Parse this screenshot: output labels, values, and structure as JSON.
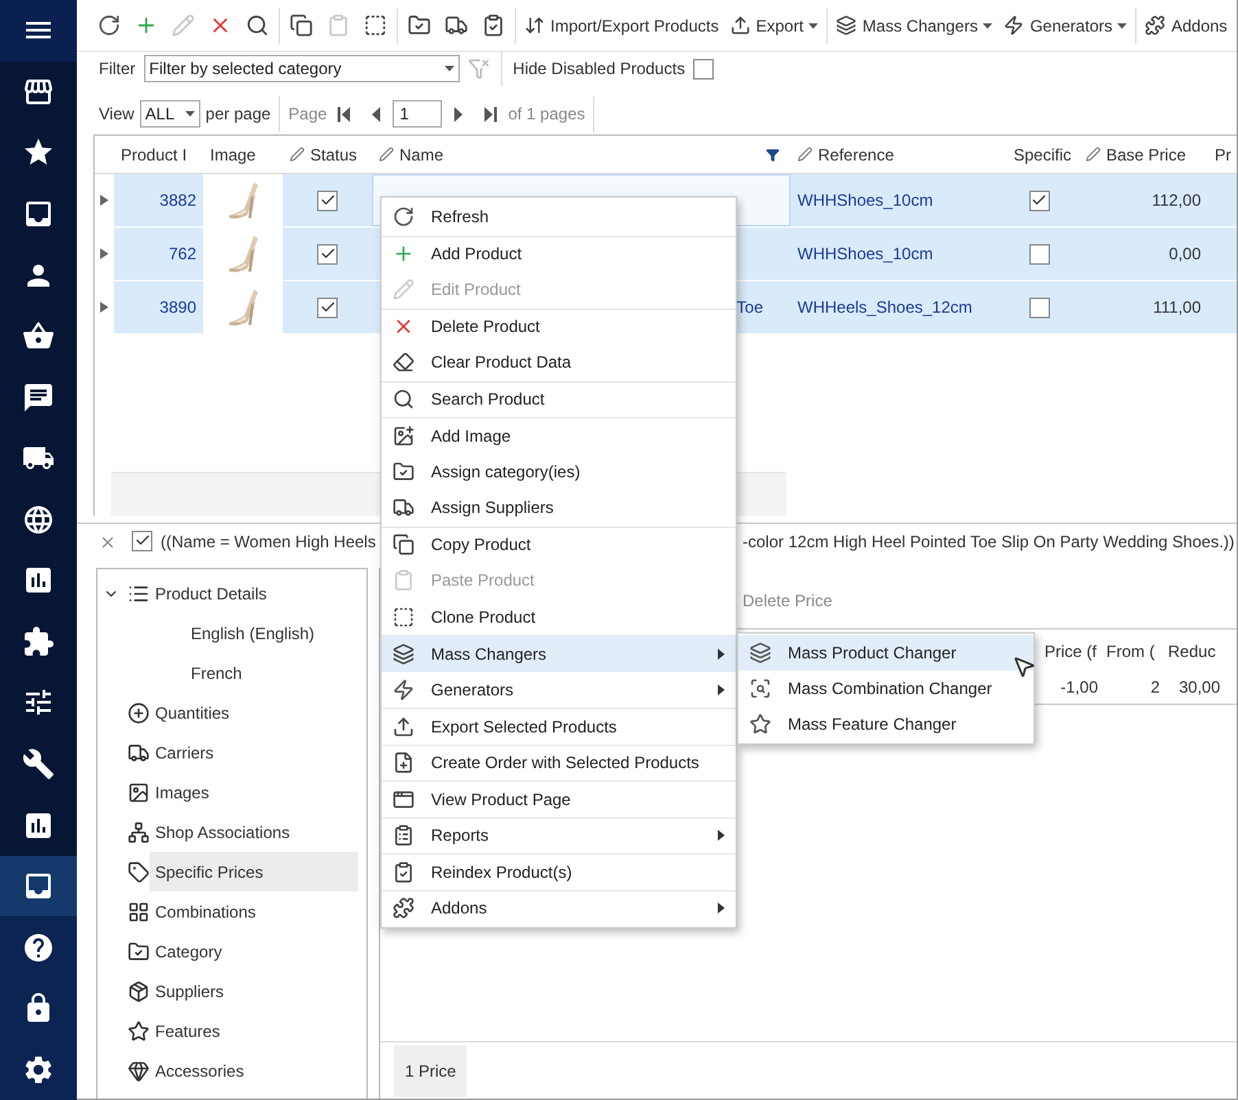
{
  "sidebar": {
    "items": [
      {
        "kind": "menu",
        "selected": false
      },
      {
        "kind": "nav",
        "selected": false
      },
      {
        "kind": "nav",
        "selected": false
      },
      {
        "kind": "nav",
        "selected": false
      },
      {
        "kind": "nav",
        "selected": false
      },
      {
        "kind": "nav",
        "selected": false
      },
      {
        "kind": "nav",
        "selected": false
      },
      {
        "kind": "nav",
        "selected": false
      },
      {
        "kind": "nav",
        "selected": false
      },
      {
        "kind": "nav",
        "selected": false
      },
      {
        "kind": "nav",
        "selected": false
      },
      {
        "kind": "nav",
        "selected": false
      },
      {
        "kind": "nav",
        "selected": false
      },
      {
        "kind": "nav",
        "selected": false
      },
      {
        "kind": "nav",
        "selected": true
      },
      {
        "kind": "utility",
        "selected": false
      },
      {
        "kind": "utility",
        "selected": false
      },
      {
        "kind": "utility",
        "selected": false
      }
    ]
  },
  "toolbar": {
    "items": [
      {
        "kind": "icon",
        "disabled": false,
        "separator_after": false
      },
      {
        "kind": "icon",
        "disabled": false,
        "separator_after": false
      },
      {
        "kind": "icon",
        "disabled": true,
        "separator_after": false
      },
      {
        "kind": "icon",
        "disabled": false,
        "separator_after": false
      },
      {
        "kind": "icon",
        "disabled": false,
        "separator_after": true
      },
      {
        "kind": "icon",
        "disabled": false,
        "separator_after": false
      },
      {
        "kind": "icon",
        "disabled": true,
        "separator_after": false
      },
      {
        "kind": "icon",
        "disabled": false,
        "separator_after": true
      },
      {
        "kind": "icon",
        "disabled": false,
        "separator_after": false
      },
      {
        "kind": "icon",
        "disabled": false,
        "separator_after": false
      },
      {
        "kind": "icon",
        "disabled": false,
        "separator_after": true
      },
      {
        "kind": "text",
        "label": "Import/Export Products",
        "dropdown": false,
        "separator_after": false
      },
      {
        "kind": "text",
        "label": "Export",
        "dropdown": true,
        "separator_after": true
      },
      {
        "kind": "text",
        "label": "Mass Changers",
        "dropdown": true,
        "separator_after": false
      },
      {
        "kind": "text",
        "label": "Generators",
        "dropdown": true,
        "separator_after": true
      },
      {
        "kind": "text",
        "label": "Addons",
        "dropdown": false,
        "separator_after": false
      }
    ]
  },
  "filter": {
    "label": "Filter",
    "value": "Filter by selected category",
    "hide_disabled_label": "Hide Disabled Products",
    "hide_disabled": false
  },
  "pager": {
    "view_label": "View",
    "per_page_value": "ALL",
    "per_page_label": "per page",
    "page_label": "Page",
    "page_value": "1",
    "of_pages": "of 1 pages"
  },
  "grid": {
    "columns": [
      {
        "label": "Product I",
        "editable": false,
        "filtered": false
      },
      {
        "label": "Image",
        "editable": false,
        "filtered": false
      },
      {
        "label": "Status",
        "editable": true,
        "filtered": false
      },
      {
        "label": "Name",
        "editable": true,
        "filtered": true
      },
      {
        "label": "Reference",
        "editable": true,
        "filtered": false
      },
      {
        "label": "Specific",
        "editable": false,
        "filtered": false
      },
      {
        "label": "Base Price",
        "editable": true,
        "filtered": false
      },
      {
        "label": "Pr",
        "editable": false,
        "filtered": false
      }
    ],
    "rows": [
      {
        "product_id": "3882",
        "status": true,
        "name_end": "",
        "reference": "WHHShoes_10cm",
        "specific": true,
        "base_price": "112,00",
        "selected": true,
        "focused": true
      },
      {
        "product_id": "762",
        "status": true,
        "name_end": "",
        "reference": "WHHShoes_10cm",
        "specific": false,
        "base_price": "0,00",
        "selected": true,
        "focused": false
      },
      {
        "product_id": "3890",
        "status": true,
        "name_end": "Toe",
        "reference": "WHHeels_Shoes_12cm",
        "specific": false,
        "base_price": "111,00",
        "selected": true,
        "focused": false
      }
    ],
    "filter_bar": {
      "enabled": true,
      "text_start": "((Name = Women High Heels",
      "text_end": "-color 12cm High Heel Pointed Toe Slip On Party Wedding Shoes.))"
    }
  },
  "detail_tree": [
    {
      "label": "Product Details",
      "expanded": true,
      "selected": false,
      "children": [
        {
          "label": "English (English)",
          "selected": false
        },
        {
          "label": "French",
          "selected": false
        }
      ]
    },
    {
      "label": "Quantities",
      "selected": false
    },
    {
      "label": "Carriers",
      "selected": false
    },
    {
      "label": "Images",
      "selected": false
    },
    {
      "label": "Shop Associations",
      "selected": false
    },
    {
      "label": "Specific Prices",
      "selected": true
    },
    {
      "label": "Combinations",
      "selected": false
    },
    {
      "label": "Category",
      "selected": false
    },
    {
      "label": "Suppliers",
      "selected": false
    },
    {
      "label": "Features",
      "selected": false
    },
    {
      "label": "Accessories",
      "selected": false
    }
  ],
  "prices_panel": {
    "toolbar": [
      {
        "label": "Delete Price",
        "disabled": true
      }
    ],
    "columns": [
      "Price (f",
      "From (",
      "Reduc"
    ],
    "rows": [
      {
        "cells": [
          "-1,00",
          "2",
          "30,00"
        ]
      }
    ],
    "footer": "1 Price"
  },
  "context_menu": {
    "items": [
      {
        "label": "Refresh",
        "disabled": false,
        "submenu": false,
        "selected": false,
        "separator_before": false
      },
      {
        "label": "Add Product",
        "disabled": false,
        "submenu": false,
        "selected": false,
        "separator_before": true
      },
      {
        "label": "Edit Product",
        "disabled": true,
        "submenu": false,
        "selected": false,
        "separator_before": false
      },
      {
        "label": "Delete Product",
        "disabled": false,
        "submenu": false,
        "selected": false,
        "separator_before": true
      },
      {
        "label": "Clear Product Data",
        "disabled": false,
        "submenu": false,
        "selected": false,
        "separator_before": false
      },
      {
        "label": "Search Product",
        "disabled": false,
        "submenu": false,
        "selected": false,
        "separator_before": true
      },
      {
        "label": "Add Image",
        "disabled": false,
        "submenu": false,
        "selected": false,
        "separator_before": true
      },
      {
        "label": "Assign category(ies)",
        "disabled": false,
        "submenu": false,
        "selected": false,
        "separator_before": false
      },
      {
        "label": "Assign Suppliers",
        "disabled": false,
        "submenu": false,
        "selected": false,
        "separator_before": false
      },
      {
        "label": "Copy Product",
        "disabled": false,
        "submenu": false,
        "selected": false,
        "separator_before": true
      },
      {
        "label": "Paste Product",
        "disabled": true,
        "submenu": false,
        "selected": false,
        "separator_before": false
      },
      {
        "label": "Clone Product",
        "disabled": false,
        "submenu": false,
        "selected": false,
        "separator_before": false
      },
      {
        "label": "Mass Changers",
        "disabled": false,
        "submenu": true,
        "selected": true,
        "separator_before": true
      },
      {
        "label": "Generators",
        "disabled": false,
        "submenu": true,
        "selected": false,
        "separator_before": false
      },
      {
        "label": "Export Selected Products",
        "disabled": false,
        "submenu": false,
        "selected": false,
        "separator_before": true
      },
      {
        "label": "Create Order with Selected Products",
        "disabled": false,
        "submenu": false,
        "selected": false,
        "separator_before": true
      },
      {
        "label": "View Product Page",
        "disabled": false,
        "submenu": false,
        "selected": false,
        "separator_before": true
      },
      {
        "label": "Reports",
        "disabled": false,
        "submenu": true,
        "selected": false,
        "separator_before": true
      },
      {
        "label": "Reindex Product(s)",
        "disabled": false,
        "submenu": false,
        "selected": false,
        "separator_before": true
      },
      {
        "label": "Addons",
        "disabled": false,
        "submenu": true,
        "selected": false,
        "separator_before": true
      }
    ]
  },
  "submenu": {
    "items": [
      {
        "label": "Mass Product Changer",
        "selected": true
      },
      {
        "label": "Mass Combination Changer",
        "selected": false
      },
      {
        "label": "Mass Feature Changer",
        "selected": false
      }
    ]
  }
}
